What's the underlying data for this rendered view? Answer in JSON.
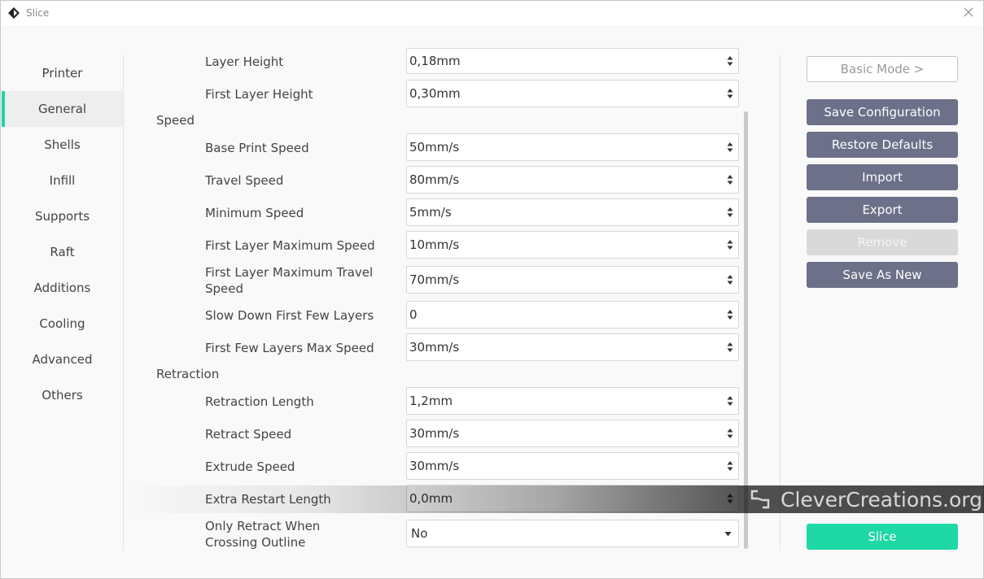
{
  "window": {
    "title": "Slice"
  },
  "sidebar": {
    "items": [
      {
        "label": "Printer"
      },
      {
        "label": "General",
        "active": true
      },
      {
        "label": "Shells"
      },
      {
        "label": "Infill"
      },
      {
        "label": "Supports"
      },
      {
        "label": "Raft"
      },
      {
        "label": "Additions"
      },
      {
        "label": "Cooling"
      },
      {
        "label": "Advanced"
      },
      {
        "label": "Others"
      }
    ]
  },
  "settings": {
    "layer_height": {
      "label": "Layer Height",
      "value": "0,18mm"
    },
    "first_layer_height": {
      "label": "First Layer Height",
      "value": "0,30mm"
    },
    "speed_header": "Speed",
    "base_print_speed": {
      "label": "Base Print Speed",
      "value": "50mm/s"
    },
    "travel_speed": {
      "label": "Travel Speed",
      "value": "80mm/s"
    },
    "minimum_speed": {
      "label": "Minimum Speed",
      "value": "5mm/s"
    },
    "first_layer_max_speed": {
      "label": "First Layer Maximum Speed",
      "value": "10mm/s"
    },
    "first_layer_max_travel_speed": {
      "label_line1": "First Layer Maximum Travel",
      "label_line2": "Speed",
      "value": "70mm/s"
    },
    "slow_down_first_layers": {
      "label": "Slow Down First Few Layers",
      "value": "0"
    },
    "first_layers_max_speed": {
      "label": "First Few Layers Max Speed",
      "value": "30mm/s"
    },
    "retraction_header": "Retraction",
    "retraction_length": {
      "label": "Retraction Length",
      "value": "1,2mm"
    },
    "retract_speed": {
      "label": "Retract Speed",
      "value": "30mm/s"
    },
    "extrude_speed": {
      "label": "Extrude Speed",
      "value": "30mm/s"
    },
    "extra_restart_length": {
      "label": "Extra Restart Length",
      "value": "0,0mm"
    },
    "only_retract_crossing": {
      "label_line1": "Only Retract When",
      "label_line2": "Crossing Outline",
      "value": "No"
    }
  },
  "actions": {
    "basic_mode": "Basic Mode >",
    "save_configuration": "Save Configuration",
    "restore_defaults": "Restore Defaults",
    "import": "Import",
    "export": "Export",
    "remove": "Remove",
    "save_as_new": "Save As New",
    "slice": "Slice"
  },
  "watermark": {
    "text": "CleverCreations.org"
  },
  "colors": {
    "accent": "#1ed4a4",
    "button_dark": "#6c7088",
    "button_disabled": "#d9d9d9"
  }
}
